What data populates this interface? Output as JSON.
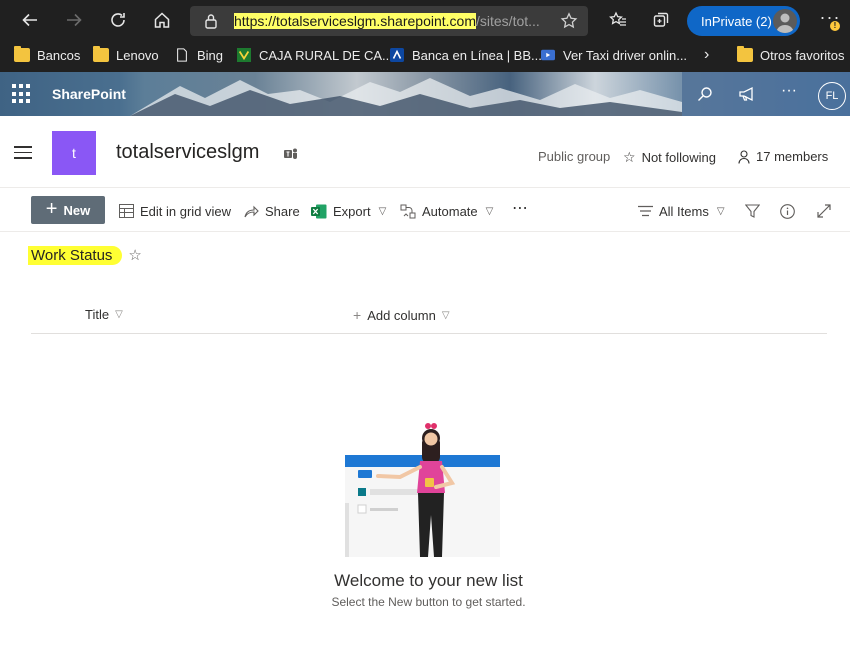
{
  "browser": {
    "url_host": "https://totalserviceslgm.sharepoint.com",
    "url_path": "/sites/tot...",
    "inprivate_label": "InPrivate (2)",
    "update_badge": "!",
    "favorites": [
      {
        "label": "Bancos",
        "icon": "folder-icon"
      },
      {
        "label": "Lenovo",
        "icon": "folder-icon"
      },
      {
        "label": "Bing",
        "icon": "page-icon"
      },
      {
        "label": "CAJA RURAL DE CA...",
        "icon": "caja-rural-icon"
      },
      {
        "label": "Banca en Línea | BB...",
        "icon": "bbva-icon"
      },
      {
        "label": "Ver Taxi driver onlin...",
        "icon": "video-icon"
      }
    ],
    "other_favorites": "Otros favoritos"
  },
  "suite": {
    "brand": "SharePoint",
    "persona_initials": "FL"
  },
  "site": {
    "logo_letter": "t",
    "title": "totalserviceslgm",
    "privacy": "Public group",
    "follow": "Not following",
    "members": "17 members"
  },
  "commands": {
    "new": "New",
    "edit_grid": "Edit in grid view",
    "share": "Share",
    "export": "Export",
    "automate": "Automate",
    "overflow": "⋯",
    "view": "All Items"
  },
  "list": {
    "title": "Work Status",
    "columns": [
      "Title",
      "Add column"
    ]
  },
  "empty_state": {
    "title": "Welcome to your new list",
    "subtitle": "Select the New button to get started."
  },
  "colors": {
    "browser_bg": "#202020",
    "url_highlight": "#ffff66",
    "inprivate": "#0f67c7",
    "site_logo": "#8a57f5",
    "new_button": "#5f6c77",
    "title_highlight": "#ffff33"
  }
}
